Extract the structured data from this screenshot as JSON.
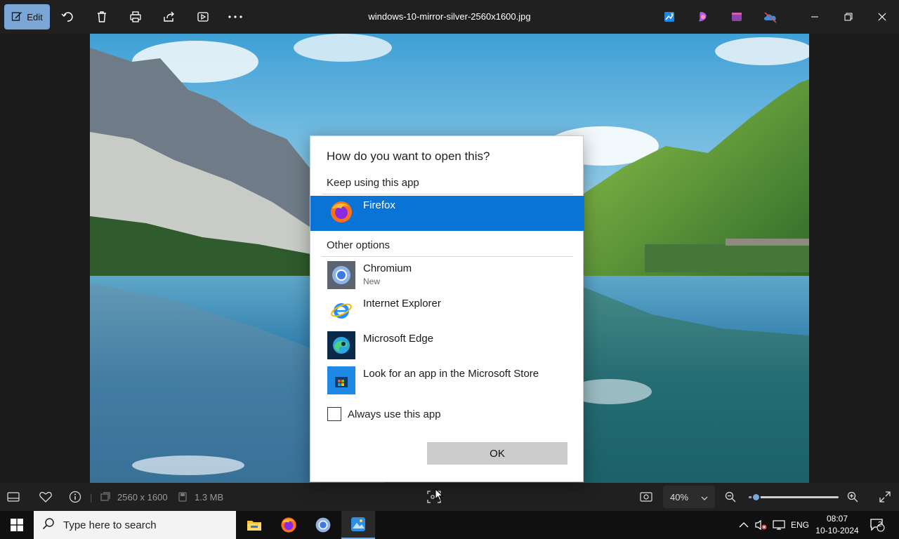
{
  "toolbar": {
    "edit_label": "Edit",
    "file_title": "windows-10-mirror-silver-2560x1600.jpg"
  },
  "status": {
    "dimensions": "2560 x 1600",
    "file_size": "1.3 MB",
    "zoom_value": "40%",
    "zoom_slider_fraction": 0.08
  },
  "dialog": {
    "title": "How do you want to open this?",
    "keep_section": "Keep using this app",
    "selected_app": {
      "name": "Firefox"
    },
    "other_section": "Other options",
    "apps": [
      {
        "name": "Chromium",
        "sub": "New"
      },
      {
        "name": "Internet Explorer",
        "sub": ""
      },
      {
        "name": "Microsoft Edge",
        "sub": ""
      },
      {
        "name": "Look for an app in the Microsoft Store",
        "sub": ""
      }
    ],
    "always_label": "Always use this app",
    "ok_label": "OK"
  },
  "taskbar": {
    "search_placeholder": "Type here to search",
    "language": "ENG",
    "time": "08:07",
    "date": "10-10-2024",
    "notification_count": "2"
  },
  "colors": {
    "accent": "#0a74d6",
    "edit_button": "#7ba6d8"
  }
}
